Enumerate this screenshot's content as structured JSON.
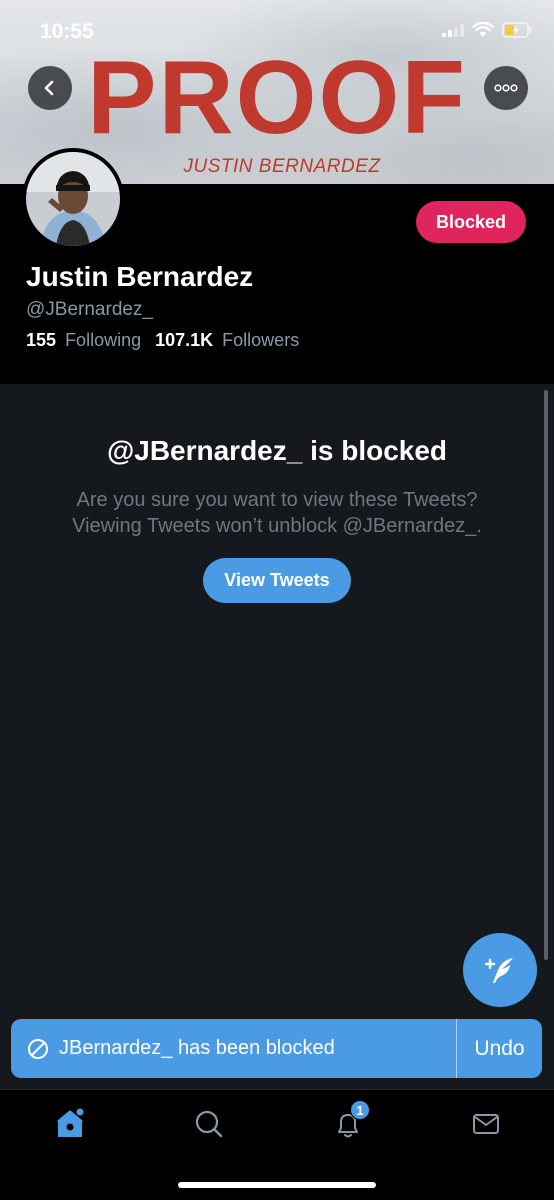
{
  "status_bar": {
    "time": "10:55"
  },
  "banner": {
    "title": "PROOF",
    "subtitle": "JUSTIN BERNARDEZ",
    "title_color": "#c0392f"
  },
  "header": {
    "back_icon": "chevron-left-icon",
    "more_icon": "more-horizontal-icon"
  },
  "profile": {
    "display_name": "Justin Bernardez",
    "handle": "@JBernardez_",
    "blocked_label": "Blocked",
    "following_count": "155",
    "following_label": "Following",
    "followers_count": "107.1K",
    "followers_label": "Followers"
  },
  "blocked_notice": {
    "title": "@JBernardez_ is blocked",
    "line1": "Are you sure you want to view these Tweets?",
    "line2": "Viewing Tweets won’t unblock @JBernardez_.",
    "button_label": "View Tweets"
  },
  "toast": {
    "icon": "blocked-circle-icon",
    "message": "JBernardez_ has been blocked",
    "action_label": "Undo"
  },
  "tabbar": {
    "items": [
      {
        "name": "home",
        "icon": "home-icon",
        "active": true
      },
      {
        "name": "search",
        "icon": "search-icon",
        "active": false
      },
      {
        "name": "notifications",
        "icon": "bell-icon",
        "active": false,
        "badge": "1"
      },
      {
        "name": "messages",
        "icon": "mail-icon",
        "active": false
      }
    ]
  },
  "colors": {
    "accent": "#4a9be4",
    "blocked": "#e0245e",
    "background": "#15181c"
  }
}
